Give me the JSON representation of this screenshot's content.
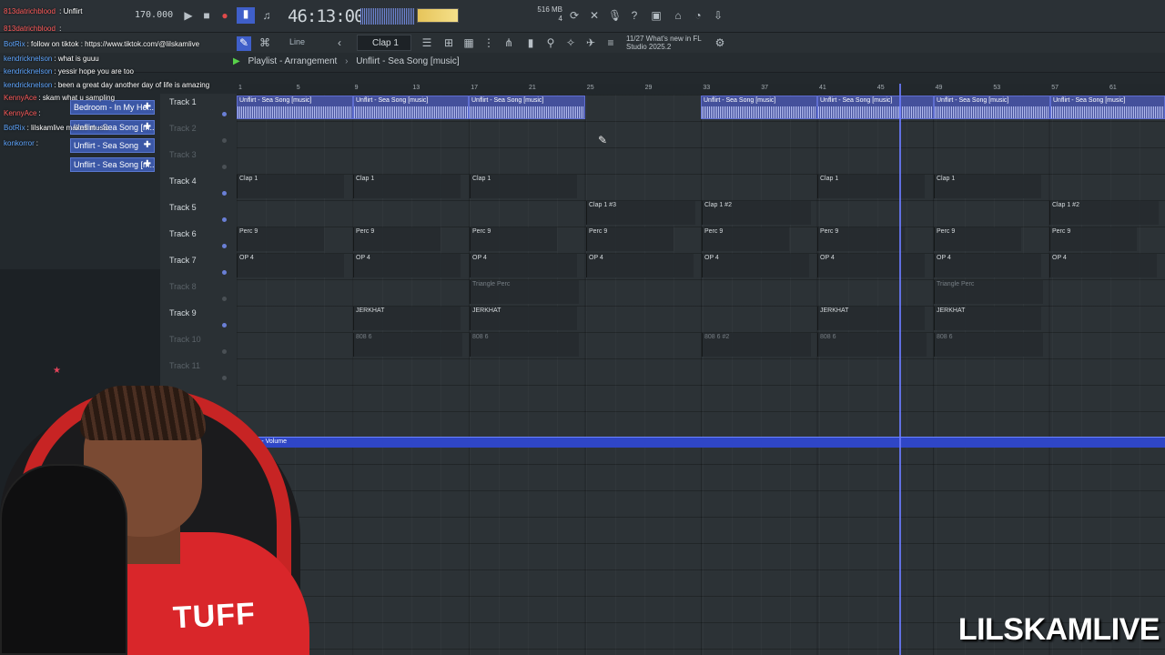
{
  "toolbar": {
    "time": "46:13:00",
    "memory": "516 MB",
    "memory_sub": "4",
    "tempo": "170.000",
    "pattern": "Clap 1",
    "snap": "Line",
    "news": "11/27  What's new in FL Studio 2025.2"
  },
  "playlist": {
    "title": "Playlist - Arrangement",
    "separator": "›",
    "song": "Unflirt - Sea Song [music]"
  },
  "chat": [
    {
      "user": "813datrichblood",
      "msg": " : Unflirt"
    },
    {
      "user": "813datrichblood",
      "msg": " :"
    },
    {
      "user": "BotRix",
      "msg": ": follow on tiktok : https://www.tiktok.com/@lilskamlive"
    },
    {
      "user": "kendricknelson",
      "msg": ": what is guuu"
    },
    {
      "user": "kendricknelson",
      "msg": ": yessir hope you are too"
    },
    {
      "user": "kendricknelson",
      "msg": ": been a great day another day of life is amazing"
    },
    {
      "user": "KennyAce",
      "msg": ": skam what u sampling"
    },
    {
      "user": "KennyAce",
      "msg": ":"
    },
    {
      "user": "BotRix",
      "msg": ": lilskamlive makes music"
    },
    {
      "user": "konkorror",
      "msg": ":"
    }
  ],
  "browser": {
    "items": [
      "Bedroom - In My He...",
      "Unflirt - Sea Song [m...",
      "Unflirt - Sea Song",
      "Unflirt - Sea Song [m..."
    ]
  },
  "tracks": [
    {
      "name": "Track 1",
      "muted": false
    },
    {
      "name": "Track 2",
      "muted": true
    },
    {
      "name": "Track 3",
      "muted": true
    },
    {
      "name": "Track 4",
      "muted": false
    },
    {
      "name": "Track 5",
      "muted": false
    },
    {
      "name": "Track 6",
      "muted": false
    },
    {
      "name": "Track 7",
      "muted": false
    },
    {
      "name": "Track 8",
      "muted": true
    },
    {
      "name": "Track 9",
      "muted": false
    },
    {
      "name": "Track 10",
      "muted": true
    },
    {
      "name": "Track 11",
      "muted": true
    }
  ],
  "ruler": [
    "1",
    "5",
    "9",
    "13",
    "17",
    "21",
    "25",
    "29",
    "33",
    "37",
    "41",
    "45",
    "49",
    "53",
    "57",
    "61"
  ],
  "clip_labels": {
    "audio": "Unflirt - Sea Song [music]",
    "clap1": "Clap 1",
    "clap1_3": "Clap 1 #3",
    "clap1_2": "Clap 1 #2",
    "perc9": "Perc 9",
    "op4": "OP 4",
    "triangle": "Triangle Perc",
    "jerkhat": "JERKHAT",
    "e808": "808 6",
    "e808_2": "808 6 #2"
  },
  "master": "Master - Volume",
  "webcam": {
    "shirt_text": "TUFF",
    "watermark": "LILSKAMLIVE"
  },
  "colors": {
    "accent": "#3b57a6",
    "playhead": "#6b7bff",
    "master": "#2f46c6"
  }
}
